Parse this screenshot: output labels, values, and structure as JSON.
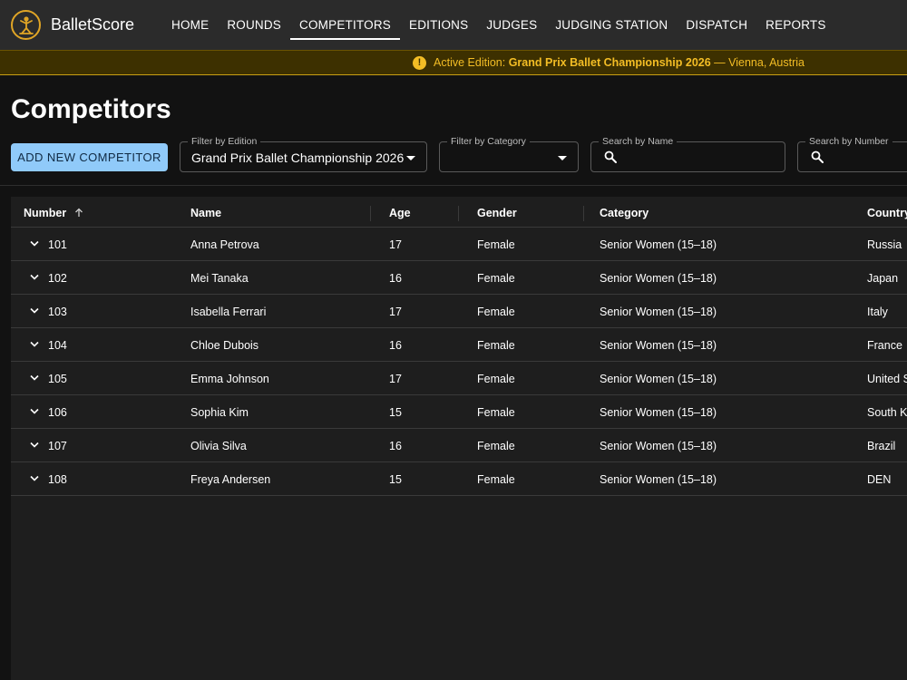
{
  "app": {
    "name": "BalletScore"
  },
  "nav": [
    {
      "label": "HOME",
      "active": false
    },
    {
      "label": "ROUNDS",
      "active": false
    },
    {
      "label": "COMPETITORS",
      "active": true
    },
    {
      "label": "EDITIONS",
      "active": false
    },
    {
      "label": "JUDGES",
      "active": false
    },
    {
      "label": "JUDGING STATION",
      "active": false
    },
    {
      "label": "DISPATCH",
      "active": false
    },
    {
      "label": "REPORTS",
      "active": false
    }
  ],
  "banner": {
    "icon": "info-icon",
    "prefix": "Active Edition: ",
    "edition": "Grand Prix Ballet Championship 2026",
    "suffix": " — Vienna, Austria"
  },
  "page": {
    "title": "Competitors"
  },
  "toolbar": {
    "add_label": "ADD NEW COMPETITOR",
    "filter_edition": {
      "label": "Filter by Edition",
      "value": "Grand Prix Ballet Championship 2026"
    },
    "filter_category": {
      "label": "Filter by Category",
      "value": ""
    },
    "search_name": {
      "label": "Search by Name",
      "value": ""
    },
    "search_number": {
      "label": "Search by Number",
      "value": ""
    }
  },
  "table": {
    "headers": [
      "Number",
      "Name",
      "Age",
      "Gender",
      "Category",
      "Country"
    ],
    "sort": {
      "column": "Number",
      "direction": "asc"
    },
    "rows": [
      {
        "number": "101",
        "name": "Anna Petrova",
        "age": "17",
        "gender": "Female",
        "category": "Senior Women (15–18)",
        "country": "Russia"
      },
      {
        "number": "102",
        "name": "Mei Tanaka",
        "age": "16",
        "gender": "Female",
        "category": "Senior Women (15–18)",
        "country": "Japan"
      },
      {
        "number": "103",
        "name": "Isabella Ferrari",
        "age": "17",
        "gender": "Female",
        "category": "Senior Women (15–18)",
        "country": "Italy"
      },
      {
        "number": "104",
        "name": "Chloe Dubois",
        "age": "16",
        "gender": "Female",
        "category": "Senior Women (15–18)",
        "country": "France"
      },
      {
        "number": "105",
        "name": "Emma Johnson",
        "age": "17",
        "gender": "Female",
        "category": "Senior Women (15–18)",
        "country": "United S"
      },
      {
        "number": "106",
        "name": "Sophia Kim",
        "age": "15",
        "gender": "Female",
        "category": "Senior Women (15–18)",
        "country": "South K"
      },
      {
        "number": "107",
        "name": "Olivia Silva",
        "age": "16",
        "gender": "Female",
        "category": "Senior Women (15–18)",
        "country": "Brazil"
      },
      {
        "number": "108",
        "name": "Freya Andersen",
        "age": "15",
        "gender": "Female",
        "category": "Senior Women (15–18)",
        "country": "DEN"
      }
    ]
  },
  "colors": {
    "accent": "#90caf9",
    "warning": "#f3bd25",
    "logo": "#e0a526"
  }
}
